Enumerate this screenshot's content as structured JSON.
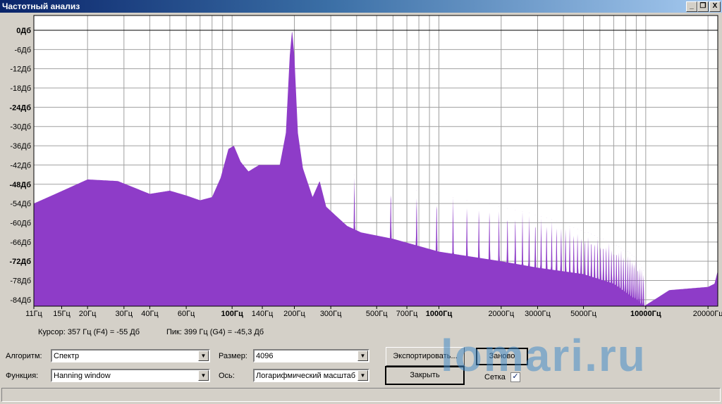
{
  "window": {
    "title": "Частотный анализ",
    "minimize": "_",
    "restore": "❐",
    "close": "X"
  },
  "chart_data": {
    "type": "area",
    "x_scale": "log",
    "xlim_hz": [
      11,
      22300
    ],
    "ylim_db": [
      -86,
      4.6
    ],
    "grid": true,
    "fill_color": "#8e3cc8",
    "y_ticks": [
      {
        "v": 0,
        "label": "0Дб",
        "bold": true
      },
      {
        "v": -6,
        "label": "-6Дб"
      },
      {
        "v": -12,
        "label": "-12Дб"
      },
      {
        "v": -18,
        "label": "-18Дб"
      },
      {
        "v": -24,
        "label": "-24Дб",
        "bold": true
      },
      {
        "v": -30,
        "label": "-30Дб"
      },
      {
        "v": -36,
        "label": "-36Дб"
      },
      {
        "v": -42,
        "label": "-42Дб"
      },
      {
        "v": -48,
        "label": "-48Дб",
        "bold": true
      },
      {
        "v": -54,
        "label": "-54Дб"
      },
      {
        "v": -60,
        "label": "-60Дб"
      },
      {
        "v": -66,
        "label": "-66Дб"
      },
      {
        "v": -72,
        "label": "-72Дб",
        "bold": true
      },
      {
        "v": -78,
        "label": "-78Дб"
      },
      {
        "v": -84,
        "label": "-84Дб"
      }
    ],
    "x_ticks": [
      {
        "v": 11,
        "label": "11Гц"
      },
      {
        "v": 15,
        "label": "15Гц"
      },
      {
        "v": 20,
        "label": "20Гц"
      },
      {
        "v": 30,
        "label": "30Гц"
      },
      {
        "v": 40,
        "label": "40Гц"
      },
      {
        "v": 60,
        "label": "60Гц"
      },
      {
        "v": 100,
        "label": "100Гц",
        "bold": true
      },
      {
        "v": 140,
        "label": "140Гц"
      },
      {
        "v": 200,
        "label": "200Гц"
      },
      {
        "v": 300,
        "label": "300Гц"
      },
      {
        "v": 500,
        "label": "500Гц"
      },
      {
        "v": 700,
        "label": "700Гц"
      },
      {
        "v": 1000,
        "label": "1000Гц",
        "bold": true
      },
      {
        "v": 2000,
        "label": "2000Гц"
      },
      {
        "v": 3000,
        "label": "3000Гц"
      },
      {
        "v": 5000,
        "label": "5000Гц"
      },
      {
        "v": 10000,
        "label": "10000Гц",
        "bold": true
      },
      {
        "v": 20000,
        "label": "20000Гц"
      }
    ],
    "x_grid": [
      20,
      30,
      40,
      50,
      60,
      70,
      80,
      90,
      100,
      200,
      300,
      400,
      500,
      600,
      700,
      800,
      900,
      1000,
      2000,
      3000,
      4000,
      5000,
      6000,
      7000,
      8000,
      9000,
      10000,
      20000
    ],
    "envelope": [
      [
        11,
        -54
      ],
      [
        14,
        -51
      ],
      [
        20,
        -46.5
      ],
      [
        28,
        -47
      ],
      [
        40,
        -51
      ],
      [
        50,
        -50
      ],
      [
        60,
        -51.5
      ],
      [
        70,
        -53
      ],
      [
        80,
        -52
      ],
      [
        88,
        -46
      ],
      [
        96,
        -37
      ],
      [
        102,
        -36
      ],
      [
        110,
        -41
      ],
      [
        120,
        -44
      ],
      [
        135,
        -42
      ],
      [
        170,
        -42
      ],
      [
        182,
        -32
      ],
      [
        190,
        -8
      ],
      [
        195,
        0
      ],
      [
        200,
        -8
      ],
      [
        208,
        -32
      ],
      [
        220,
        -43
      ],
      [
        245,
        -52
      ],
      [
        265,
        -47
      ],
      [
        285,
        -55
      ],
      [
        320,
        -58
      ],
      [
        360,
        -61
      ],
      [
        420,
        -63
      ],
      [
        600,
        -65
      ],
      [
        1000,
        -69
      ],
      [
        2000,
        -72
      ],
      [
        3000,
        -74
      ],
      [
        5000,
        -76
      ],
      [
        7000,
        -79
      ],
      [
        9000,
        -84
      ],
      [
        9800,
        -86
      ],
      [
        11000,
        -84
      ],
      [
        13000,
        -81
      ],
      [
        20000,
        -80
      ],
      [
        21500,
        -79
      ],
      [
        22300,
        -75
      ]
    ],
    "harmonic_fundamental_hz": 195,
    "harmonic_peaks_db": [
      -45,
      -48,
      -50,
      -51,
      -52,
      -53,
      -53.5,
      -54,
      -55,
      -55.5,
      -56,
      -56.5,
      -57,
      -57.5,
      -58,
      -58.5,
      -59,
      -59.5,
      -60,
      -60.5,
      -61,
      -61.5,
      -62,
      -62.5,
      -63,
      -63,
      -63.5,
      -64,
      -64.5,
      -65,
      -65,
      -65.5,
      -66,
      -66.5,
      -67,
      -67,
      -67.5,
      -68,
      -68.5,
      -69,
      -69,
      -69.5,
      -70,
      -70.5,
      -71,
      -72,
      -73,
      -74,
      -75
    ]
  },
  "status": {
    "cursor": "Курсор: 357 Гц (F4) = -55 Дб",
    "peak": "Пик: 399 Гц (G4) = -45,3 Дб"
  },
  "controls": {
    "algorithm_label": "Алгоритм:",
    "algorithm_value": "Спектр",
    "function_label": "Функция:",
    "function_value": "Hanning window",
    "size_label": "Размер:",
    "size_value": "4096",
    "axis_label": "Ось:",
    "axis_value": "Логарифмический масштаб",
    "export_button": "Экспортировать...",
    "redo_button": "Заново",
    "close_button": "Закрыть",
    "grid_label": "Сетка",
    "grid_checked": true
  },
  "watermark": "lomari.ru"
}
